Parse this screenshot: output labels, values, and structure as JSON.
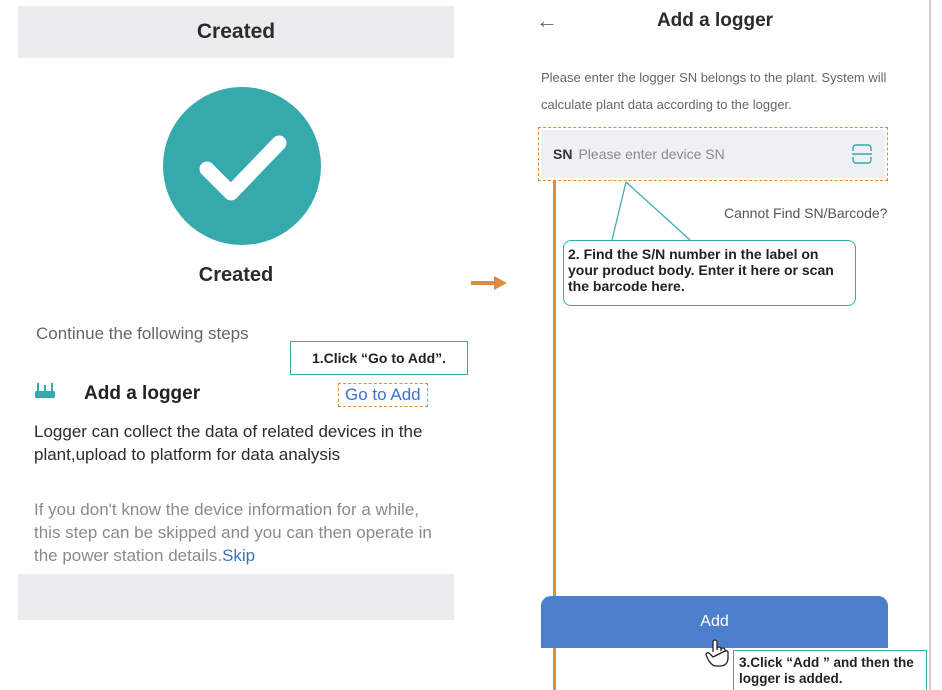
{
  "left_screen": {
    "header_title": "Created",
    "success_title": "Created",
    "steps_intro": "Continue the following steps",
    "logger_title": "Add a logger",
    "go_to_add": "Go to Add",
    "logger_desc": "Logger can collect the data of related devices in the plant,upload to platform for data analysis",
    "skip_note": "If you don't know the device information for a while, this step can be skipped and you can then operate in the power station details.",
    "skip_link": "Skip"
  },
  "right_screen": {
    "title": "Add a logger",
    "instruction": "Please enter the logger SN belongs to the plant. System will calculate plant data according to the logger.",
    "sn_label": "SN",
    "sn_placeholder": "Please enter device SN",
    "cannot_find": "Cannot Find SN/Barcode?",
    "add_button": "Add"
  },
  "callouts": {
    "step1": "1.Click “Go to Add”.",
    "step2": "2. Find the S/N number in the label on your product body. Enter it here or scan the barcode here.",
    "step3": "3.Click “Add ” and then the logger is added."
  },
  "colors": {
    "teal": "#36a9ad",
    "orange": "#e08a3c",
    "link_blue": "#3b73c4",
    "button_blue": "#4b7fcb",
    "header_gray": "#ececee"
  },
  "icons": {
    "success": "checkmark-icon",
    "logger": "logger-icon",
    "back": "back-arrow-icon",
    "scan": "scan-barcode-icon",
    "pointer": "hand-pointer-icon",
    "flow": "right-arrow-icon"
  }
}
